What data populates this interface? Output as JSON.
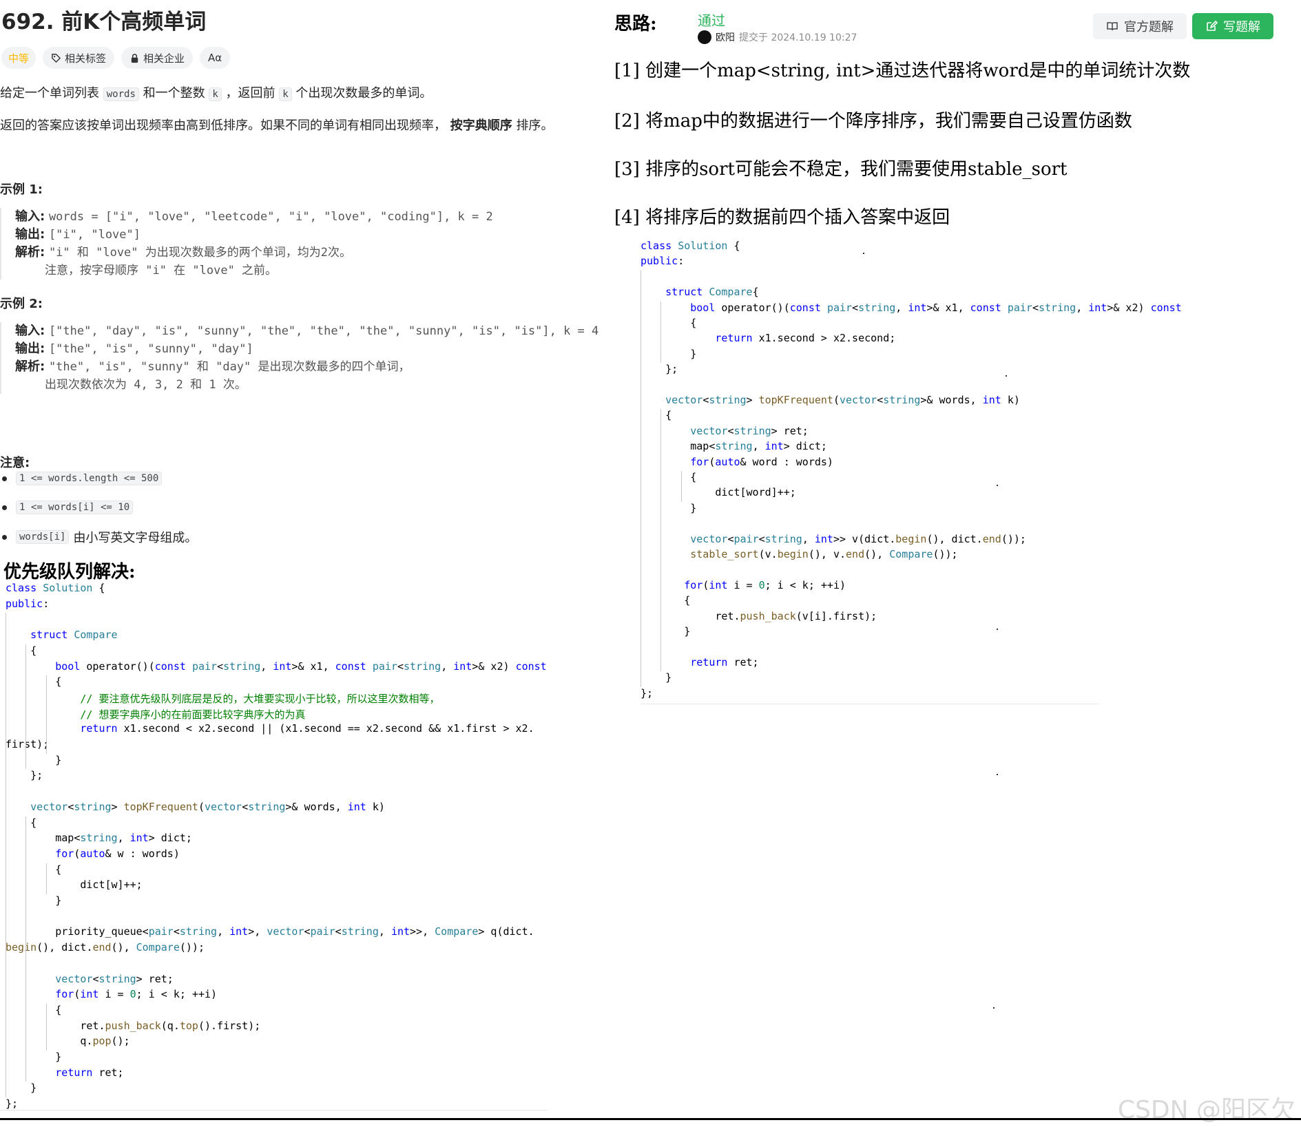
{
  "problem": {
    "title": "692. 前K个高频单词",
    "tags": {
      "difficulty": "中等",
      "related_tags": "相关标签",
      "related_companies": "相关企业",
      "font_icon": "Aα"
    },
    "desc1": {
      "a": "给定一个单词列表 ",
      "code1": "words",
      "b": " 和一个整数 ",
      "code2": "k",
      "c": " ，返回前 ",
      "code3": "k",
      "d": " 个出现次数最多的单词。"
    },
    "desc2": {
      "a": "返回的答案应该按单词出现频率由高到低排序。如果不同的单词有相同出现频率， ",
      "bold": "按字典顺序",
      "c": " 排序。"
    },
    "example1": {
      "heading": "示例 1:",
      "in_label": "输入:",
      "in_value": "words = [\"i\", \"love\", \"leetcode\", \"i\", \"love\", \"coding\"], k = 2",
      "out_label": "输出:",
      "out_value": "[\"i\", \"love\"]",
      "exp_label": "解析:",
      "exp_value": "\"i\" 和 \"love\" 为出现次数最多的两个单词，均为2次。",
      "exp_cont": "注意，按字母顺序 \"i\" 在 \"love\" 之前。"
    },
    "example2": {
      "heading": "示例 2:",
      "in_label": "输入:",
      "in_value": "[\"the\", \"day\", \"is\", \"sunny\", \"the\", \"the\", \"the\", \"sunny\", \"is\", \"is\"], k = 4",
      "out_label": "输出:",
      "out_value": "[\"the\", \"is\", \"sunny\", \"day\"]",
      "exp_label": "解析:",
      "exp_value": "\"the\", \"is\", \"sunny\" 和 \"day\" 是出现次数最多的四个单词，",
      "exp_cont": "出现次数依次为 4, 3, 2 和 1 次。"
    },
    "notes": {
      "heading": "注意:",
      "items": [
        "1 <= words.length <= 500",
        "1 <= words[i] <= 10"
      ],
      "item3_code": "words[i]",
      "item3_text": " 由小写英文字母组成。"
    }
  },
  "pq_solution": {
    "heading": "优先级队列解决:",
    "lines": [
      "class Solution {",
      "public:",
      "",
      "    struct Compare",
      "    {",
      "        bool operator()(const pair<string, int>& x1, const pair<string, int>& x2) const",
      "        {",
      "            // 要注意优先级队列底层是反的，大堆要实现小于比较，所以这里次数相等，",
      "            // 想要字典序小的在前面要比较字典序大的为真",
      "            return x1.second < x2.second || (x1.second == x2.second && x1.first > x2.",
      "first);",
      "        }",
      "    };",
      "",
      "    vector<string> topKFrequent(vector<string>& words, int k)",
      "    {",
      "        map<string, int> dict;",
      "        for(auto& w : words)",
      "        {",
      "            dict[w]++;",
      "        }",
      "",
      "        priority_queue<pair<string, int>, vector<pair<string, int>>, Compare> q(dict.",
      "begin(), dict.end(), Compare());",
      "",
      "        vector<string> ret;",
      "        for(int i = 0; i < k; ++i)",
      "        {",
      "            ret.push_back(q.top().first);",
      "            q.pop();",
      "        }",
      "        return ret;",
      "    }",
      "};"
    ]
  },
  "solution": {
    "heading": "思路:",
    "status": "通过",
    "author": "欧阳",
    "submitted": "提交于 2024.10.19 10:27",
    "official_button": "官方题解",
    "write_button": "写题解",
    "steps": [
      "[1] 创建一个map<string, int>通过迭代器将word是中的单词统计次数",
      "[2] 将map中的数据进行一个降序排序，我们需要自己设置仿函数",
      "[3] 排序的sort可能会不稳定，我们需要使用stable_sort",
      "[4] 将排序后的数据前四个插入答案中返回"
    ],
    "code_lines": [
      "class Solution {",
      "public:",
      "",
      "    struct Compare{",
      "        bool operator()(const pair<string, int>& x1, const pair<string, int>& x2) const",
      "        {",
      "            return x1.second > x2.second;",
      "        }",
      "    };",
      "",
      "    vector<string> topKFrequent(vector<string>& words, int k)",
      "    {",
      "        vector<string> ret;",
      "        map<string, int> dict;",
      "        for(auto& word : words)",
      "        {",
      "            dict[word]++;",
      "        }",
      "",
      "        vector<pair<string, int>> v(dict.begin(), dict.end());",
      "        stable_sort(v.begin(), v.end(), Compare());",
      "",
      "       for(int i = 0; i < k; ++i)",
      "       {",
      "            ret.push_back(v[i].first);",
      "       }",
      "",
      "        return ret;",
      "    }",
      "};"
    ]
  },
  "watermark": "CSDN @阳区欠",
  "colors": {
    "accent_green": "#2db55d",
    "difficulty_yellow": "#ffb800",
    "keyword_blue": "#0000ff",
    "type_teal": "#267f99",
    "comment_green": "#008000"
  }
}
